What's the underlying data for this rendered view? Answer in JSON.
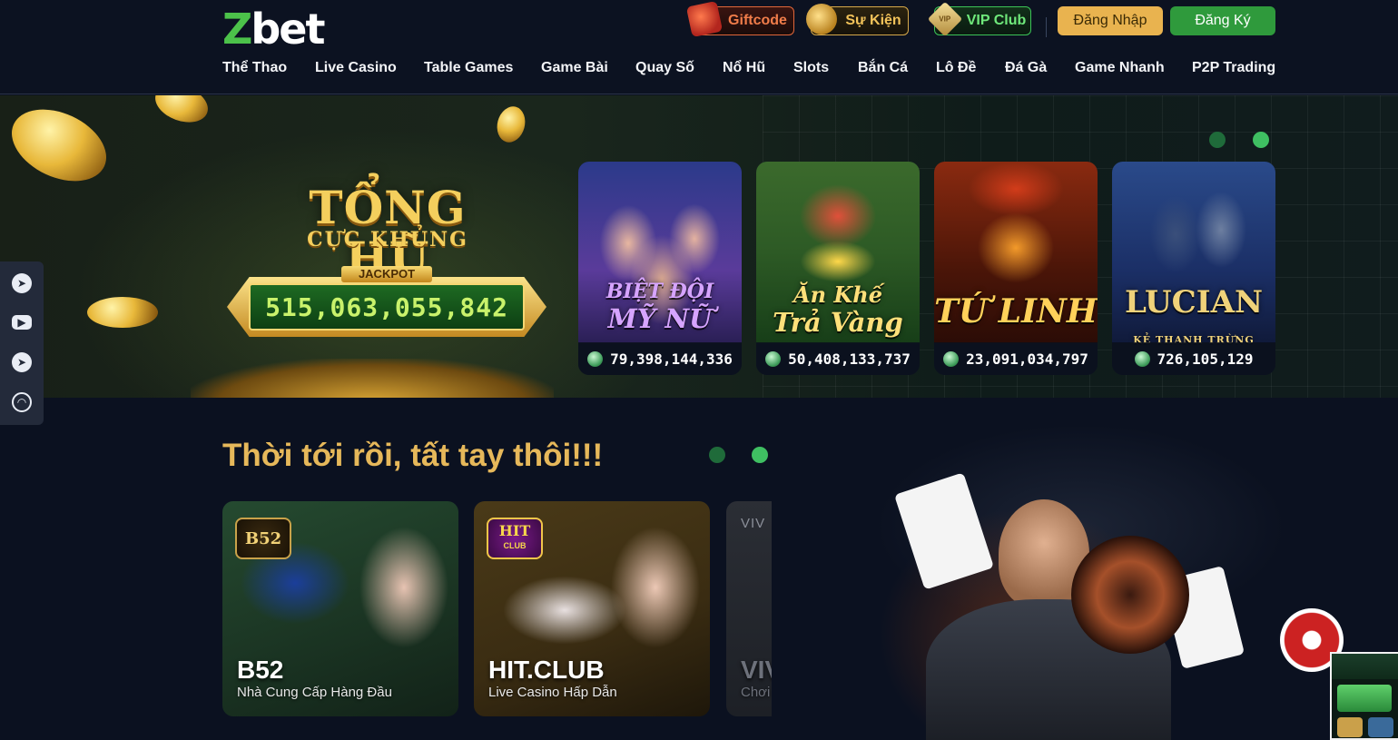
{
  "header": {
    "logo": {
      "z": "Z",
      "rest": "bet"
    },
    "actions": {
      "giftcode": "Giftcode",
      "event": "Sự Kiện",
      "vip_badge": "VIP",
      "vip": "VIP Club",
      "login": "Đăng Nhập",
      "register": "Đăng Ký"
    },
    "nav": [
      "Thể Thao",
      "Live Casino",
      "Table Games",
      "Game Bài",
      "Quay Số",
      "Nổ Hũ",
      "Slots",
      "Bắn Cá",
      "Lô Đề",
      "Đá Gà",
      "Game Nhanh",
      "P2P Trading"
    ]
  },
  "hero": {
    "title": "TỔNG HŨ",
    "subtitle": "CỰC KHỦNG",
    "jackpot_label": "JACKPOT",
    "jackpot_value": "515,063,055,842",
    "games": [
      {
        "name_line1": "BIỆT ĐỘI",
        "name_line2": "MỸ NỮ",
        "amount": "79,398,144,336",
        "accent": "#c77dff"
      },
      {
        "name_line1": "Ăn Khế",
        "name_line2": "Trả Vàng",
        "amount": "50,408,133,737",
        "accent": "#f5c542"
      },
      {
        "name_line1": "TỨ LINH",
        "name_line2": "",
        "amount": "23,091,034,797",
        "accent": "#ffcc4d"
      },
      {
        "name_line1": "LUCIAN",
        "name_line2": "KẺ THANH TRỪNG",
        "amount": "726,105,129",
        "accent": "#f0d27a"
      }
    ]
  },
  "sidebar": {
    "icons": [
      "telegram-icon",
      "youtube-icon",
      "telegram-icon",
      "headset-icon"
    ]
  },
  "lobby": {
    "title": "Thời tới rồi, tất tay thôi!!!",
    "cards": [
      {
        "badge": "B52",
        "name": "B52",
        "desc": "Nhà Cung Cấp Hàng Đầu"
      },
      {
        "badge": "HIT",
        "badge_sub": "CLUB",
        "name": "HIT.CLUB",
        "desc": "Live Casino Hấp Dẫn"
      },
      {
        "badge": "VIV",
        "name": "VIV",
        "desc": "Chơi"
      }
    ]
  },
  "colors": {
    "brand_green": "#4cc24a",
    "gold": "#e6b85a",
    "login_bg": "#e9b34f",
    "register_bg": "#2f9a3c",
    "page_bg": "#0b1120"
  }
}
